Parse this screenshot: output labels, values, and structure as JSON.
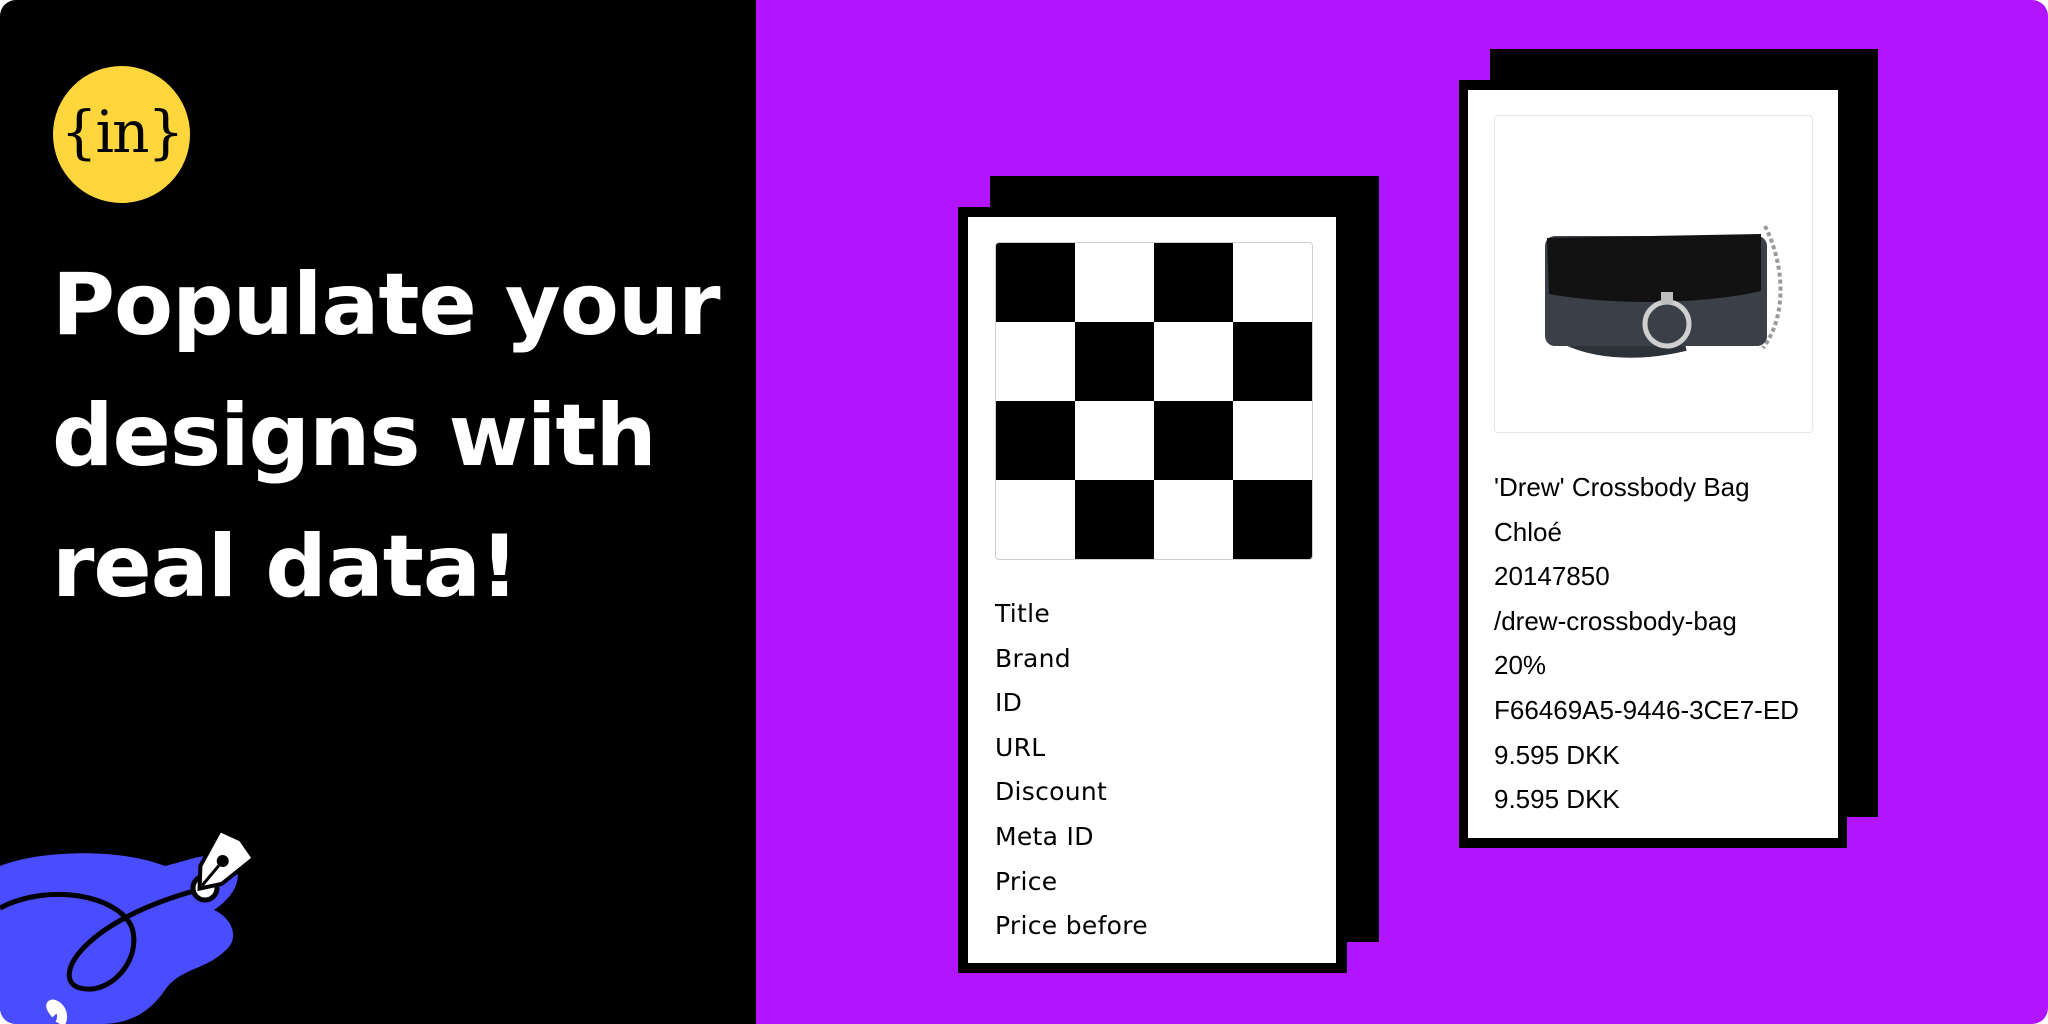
{
  "colors": {
    "left_background": "#000000",
    "right_background": "#b314ff",
    "logo_background": "#ffd73c",
    "pen_blue": "#4a4cff",
    "card_border": "#000000",
    "card_face": "#ffffff"
  },
  "logo": {
    "text": "{in}"
  },
  "hero": {
    "line1": "Populate your",
    "line2": "designs with",
    "line3": "real data!"
  },
  "template_card": {
    "image_placeholder": "checkerboard-placeholder",
    "fields": [
      "Title",
      "Brand",
      "ID",
      "URL",
      "Discount",
      "Meta ID",
      "Price",
      "Price before"
    ]
  },
  "data_card": {
    "image": "crossbody-bag-photo",
    "values": [
      "'Drew' Crossbody Bag",
      "Chloé",
      "20147850",
      "/drew-crossbody-bag",
      "20%",
      "F66469A5-9446-3CE7-ED",
      "9.595 DKK",
      "9.595 DKK"
    ]
  }
}
